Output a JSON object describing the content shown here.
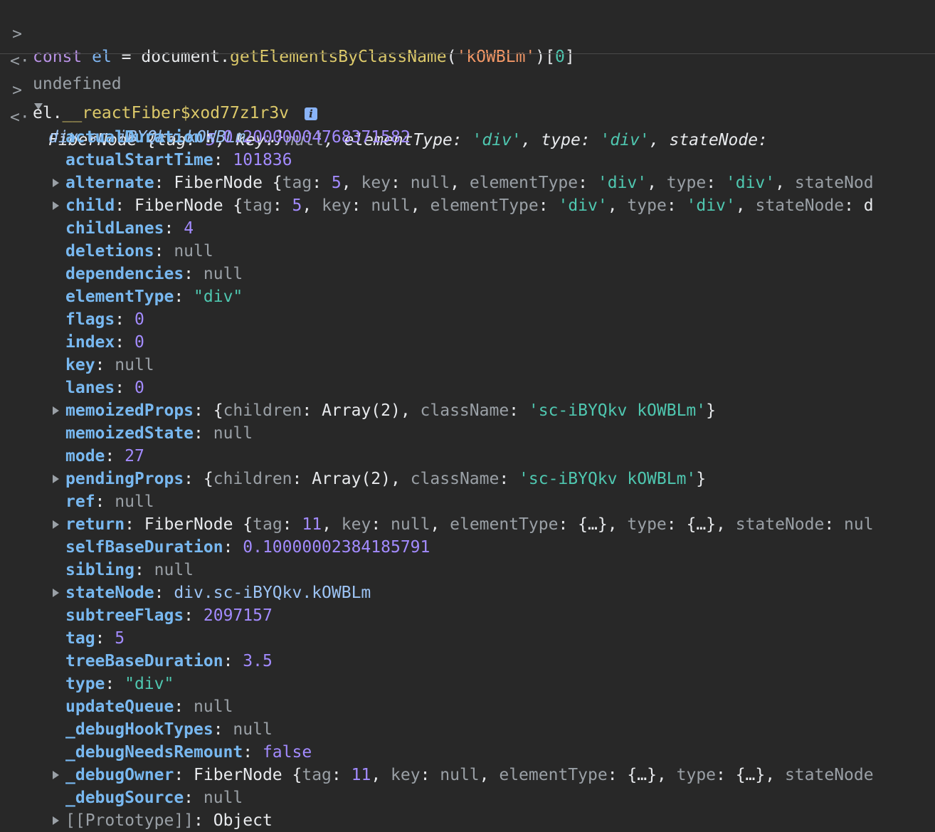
{
  "input1": {
    "prompt": ">",
    "kw": "const",
    "var": "el",
    "eq": " = ",
    "obj": "document.",
    "fn": "getElementsByClassName",
    "open": "(",
    "arg": "'kOWBLm'",
    "close": ")[",
    "idx": "0",
    "end": "]"
  },
  "result1": {
    "prompt": "<·",
    "text": "undefined"
  },
  "input2": {
    "prompt": ">",
    "obj": "el.",
    "prop": "__reactFiber$xod77z1r3v"
  },
  "result2": {
    "prompt": "<·",
    "summary_line1": {
      "name": "FiberNode ",
      "p1": "{tag: ",
      "v1": "5",
      "p2": ", key: ",
      "v2": "null",
      "p3": ", elementType: ",
      "v3": "'div'",
      "p4": ", type: ",
      "v4": "'div'",
      "p5": ", stateNode:"
    },
    "summary_line2": {
      "cls": "div.sc-iBYQkv.kOWBLm",
      "rest": ", …}"
    },
    "info": "i"
  },
  "props": [
    {
      "key": "actualDuration",
      "val": "0.20000004768371582",
      "kind": "num",
      "expand": false
    },
    {
      "key": "actualStartTime",
      "val": "101836",
      "kind": "num",
      "expand": false
    },
    {
      "key": "alternate",
      "val": "FiberNode {tag: 5, key: null, elementType: 'div', type: 'div', stateNod",
      "kind": "obj",
      "expand": true
    },
    {
      "key": "child",
      "val": "FiberNode {tag: 5, key: null, elementType: 'div', type: 'div', stateNode: d",
      "kind": "obj",
      "expand": true
    },
    {
      "key": "childLanes",
      "val": "4",
      "kind": "num",
      "expand": false
    },
    {
      "key": "deletions",
      "val": "null",
      "kind": "null",
      "expand": false
    },
    {
      "key": "dependencies",
      "val": "null",
      "kind": "null",
      "expand": false
    },
    {
      "key": "elementType",
      "val": "\"div\"",
      "kind": "str",
      "expand": false
    },
    {
      "key": "flags",
      "val": "0",
      "kind": "num",
      "expand": false
    },
    {
      "key": "index",
      "val": "0",
      "kind": "num",
      "expand": false
    },
    {
      "key": "key",
      "val": "null",
      "kind": "null",
      "expand": false
    },
    {
      "key": "lanes",
      "val": "0",
      "kind": "num",
      "expand": false
    },
    {
      "key": "memoizedProps",
      "val": "{children: Array(2), className: 'sc-iBYQkv kOWBLm'}",
      "kind": "obj",
      "expand": true
    },
    {
      "key": "memoizedState",
      "val": "null",
      "kind": "null",
      "expand": false
    },
    {
      "key": "mode",
      "val": "27",
      "kind": "num",
      "expand": false
    },
    {
      "key": "pendingProps",
      "val": "{children: Array(2), className: 'sc-iBYQkv kOWBLm'}",
      "kind": "obj",
      "expand": true
    },
    {
      "key": "ref",
      "val": "null",
      "kind": "null",
      "expand": false
    },
    {
      "key": "return",
      "val": "FiberNode {tag: 11, key: null, elementType: {…}, type: {…}, stateNode: nul",
      "kind": "obj",
      "expand": true
    },
    {
      "key": "selfBaseDuration",
      "val": "0.10000002384185791",
      "kind": "num",
      "expand": false
    },
    {
      "key": "sibling",
      "val": "null",
      "kind": "null",
      "expand": false
    },
    {
      "key": "stateNode",
      "val": "div.sc-iBYQkv.kOWBLm",
      "kind": "cls",
      "expand": true
    },
    {
      "key": "subtreeFlags",
      "val": "2097157",
      "kind": "num",
      "expand": false
    },
    {
      "key": "tag",
      "val": "5",
      "kind": "num",
      "expand": false
    },
    {
      "key": "treeBaseDuration",
      "val": "3.5",
      "kind": "num",
      "expand": false
    },
    {
      "key": "type",
      "val": "\"div\"",
      "kind": "str",
      "expand": false
    },
    {
      "key": "updateQueue",
      "val": "null",
      "kind": "null",
      "expand": false
    },
    {
      "key": "_debugHookTypes",
      "val": "null",
      "kind": "null",
      "expand": false
    },
    {
      "key": "_debugNeedsRemount",
      "val": "false",
      "kind": "num",
      "expand": false
    },
    {
      "key": "_debugOwner",
      "val": "FiberNode {tag: 11, key: null, elementType: {…}, type: {…}, stateNode",
      "kind": "obj",
      "expand": true
    },
    {
      "key": "_debugSource",
      "val": "null",
      "kind": "null",
      "expand": false
    },
    {
      "key": "[[Prototype]]",
      "val": "Object",
      "kind": "proto",
      "expand": true
    }
  ]
}
